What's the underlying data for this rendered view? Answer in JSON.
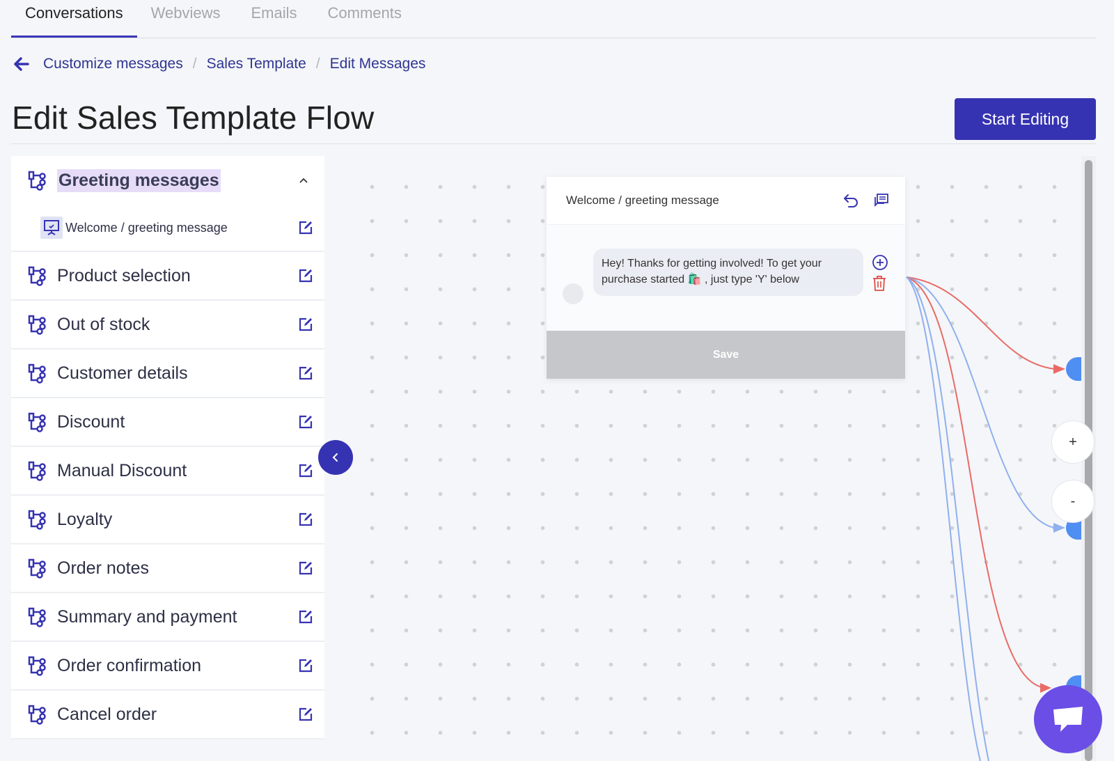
{
  "tabs": [
    {
      "label": "Conversations",
      "active": true
    },
    {
      "label": "Webviews",
      "active": false
    },
    {
      "label": "Emails",
      "active": false
    },
    {
      "label": "Comments",
      "active": false
    }
  ],
  "breadcrumb": [
    "Customize messages",
    "Sales Template",
    "Edit Messages"
  ],
  "page_title": "Edit Sales Template Flow",
  "start_editing_label": "Start Editing",
  "sidebar": {
    "expanded_group": {
      "label": "Greeting messages",
      "sub_items": [
        {
          "label": "Welcome / greeting message"
        }
      ]
    },
    "groups": [
      {
        "label": "Product selection"
      },
      {
        "label": "Out of stock"
      },
      {
        "label": "Customer details"
      },
      {
        "label": "Discount"
      },
      {
        "label": "Manual Discount"
      },
      {
        "label": "Loyalty"
      },
      {
        "label": "Order notes"
      },
      {
        "label": "Summary and payment"
      },
      {
        "label": "Order confirmation"
      },
      {
        "label": "Cancel order"
      }
    ]
  },
  "node": {
    "title": "Welcome / greeting message",
    "message": "Hey! Thanks for getting involved! To get your purchase started 🛍️ , just type 'Y' below",
    "save_label": "Save"
  },
  "zoom": {
    "in_label": "+",
    "out_label": "-"
  },
  "colors": {
    "accent": "#3633b2",
    "edge_red": "#e96b66",
    "edge_blue": "#8fb0ee",
    "chat": "#6a4ee6",
    "highlight": "#e7dcf8"
  }
}
